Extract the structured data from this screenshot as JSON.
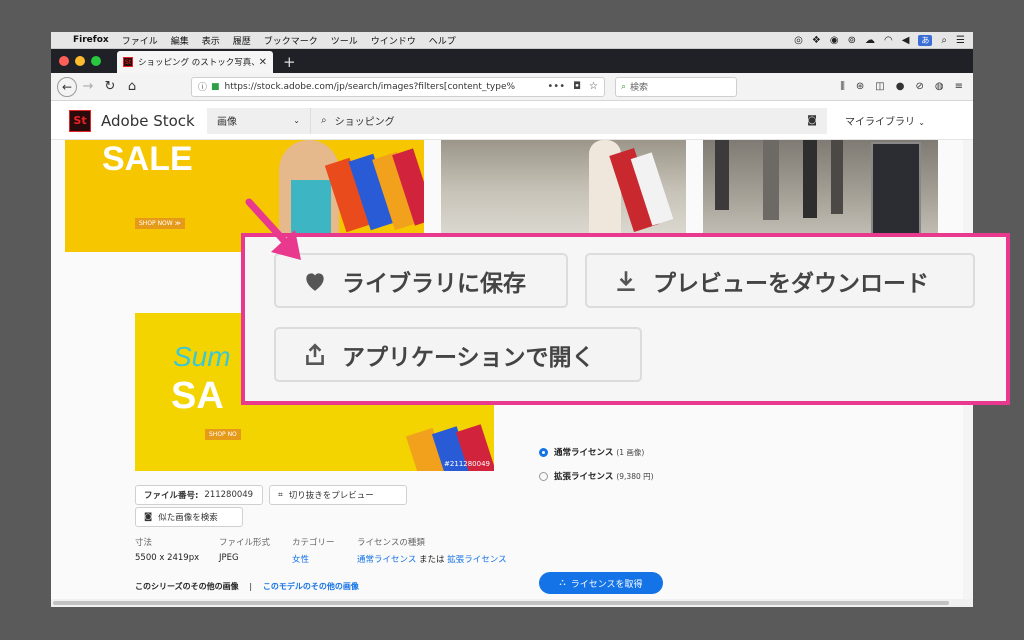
{
  "menubar": {
    "apple": "",
    "app": "Firefox",
    "items": [
      "ファイル",
      "編集",
      "表示",
      "履歴",
      "ブックマーク",
      "ツール",
      "ウインドウ",
      "ヘルプ"
    ],
    "ime": "あ"
  },
  "tab": {
    "title": "ショッピング のストック写真、ロイヤリティ",
    "favicon": "St"
  },
  "nav": {
    "url": "https://stock.adobe.com/jp/search/images?filters[content_type%",
    "search_placeholder": "検索"
  },
  "stock": {
    "logo": "St",
    "brand": "Adobe Stock",
    "type_select": "画像",
    "query": "ショッピング",
    "my_library": "マイライブラリ"
  },
  "banner": {
    "sale": "SALE",
    "shop_now": "SHOP NOW ≫"
  },
  "detail": {
    "summer": "Sum",
    "sale": "SA",
    "shop_now": "SHOP NO",
    "image_id": "#211280049",
    "file_number_label": "ファイル番号:",
    "file_number": "211280049",
    "crop_preview": "切り抜きをプレビュー",
    "similar_search": "似た画像を検索",
    "meta": {
      "size_label": "寸法",
      "size_value": "5500 x 2419px",
      "format_label": "ファイル形式",
      "format_value": "JPEG",
      "category_label": "カテゴリー",
      "category_value": "女性",
      "license_type_label": "ライセンスの種類",
      "license_standard": "通常ライセンス",
      "license_or": "または",
      "license_extended": "拡張ライセンス"
    },
    "series_label": "このシリーズのその他の画像",
    "model_label": "このモデルのその他の画像"
  },
  "license": {
    "standard_label": "通常ライセンス",
    "standard_detail": "(1 画像)",
    "extended_label": "拡張ライセンス",
    "extended_detail": "(9,380 円)",
    "get_button": "ライセンスを取得"
  },
  "callout": {
    "save_library": "ライブラリに保存",
    "download_preview": "プレビューをダウンロード",
    "open_in_app": "アプリケーションで開く"
  },
  "colors": {
    "accent": "#1473e6",
    "highlight": "#e8398f",
    "adobe_red": "#ed2224",
    "banner_yellow": "#f6c600"
  }
}
